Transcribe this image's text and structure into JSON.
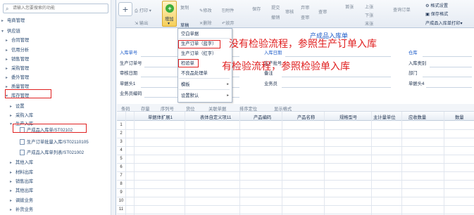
{
  "sidebar": {
    "search_placeholder": "请输入您要搜索的功能",
    "items": [
      {
        "t": "电商管理",
        "toggle": "▸"
      },
      {
        "t": "供应链",
        "toggle": "▾"
      },
      {
        "t": "合同管理",
        "toggle": "▸"
      },
      {
        "t": "信用分析",
        "toggle": "▸"
      },
      {
        "t": "销售管理",
        "toggle": "▸"
      },
      {
        "t": "采购管理",
        "toggle": "▸"
      },
      {
        "t": "委外管理",
        "toggle": "▸"
      },
      {
        "t": "质量管理",
        "toggle": "▸"
      },
      {
        "t": "库存管理",
        "toggle": "▾"
      },
      {
        "t": "设置",
        "toggle": "▸"
      },
      {
        "t": "采购入库",
        "toggle": "▸"
      },
      {
        "t": "生产入库",
        "toggle": "▾"
      },
      {
        "t": "产成品入库单/ST02102",
        "toggle": ""
      },
      {
        "t": "生产订单批量入库/ST02110105",
        "toggle": ""
      },
      {
        "t": "产成品入库单列表/ST021002",
        "toggle": ""
      },
      {
        "t": "其他入库",
        "toggle": "▸"
      },
      {
        "t": "材料出库",
        "toggle": "▸"
      },
      {
        "t": "销售出库",
        "toggle": "▸"
      },
      {
        "t": "其他出库",
        "toggle": "▸"
      },
      {
        "t": "调拨业务",
        "toggle": "▸"
      },
      {
        "t": "补货业务",
        "toggle": "▸"
      }
    ]
  },
  "toolbar": {
    "print": "打印",
    "output": "输出",
    "add": "增加",
    "add_caret": "▾",
    "copy": "复制",
    "draft": "草稿",
    "modify": "修改",
    "delete": "删除",
    "attach": "附件",
    "discard": "放弃",
    "save": "保存",
    "submit": "提交",
    "withdraw": "撤销",
    "audit": "审核",
    "abandon": "弃审",
    "view": "查审",
    "first": "首张",
    "prev": "上张",
    "next": "下张",
    "last": "末张",
    "query_order": "查询订单",
    "format_settings": "格式设置",
    "save_format": "保存格式",
    "print_template": "产成品入库单打印▾"
  },
  "menu": [
    {
      "t": "空白单据",
      "arrow": ""
    },
    {
      "t": "生产订单（蓝字）",
      "arrow": ""
    },
    {
      "t": "生产订单（红字）",
      "arrow": ""
    },
    {
      "t": "检验单",
      "arrow": ""
    },
    {
      "t": "不良品处理单",
      "arrow": ""
    },
    {
      "t": "模板",
      "arrow": "▸"
    },
    {
      "t": "设置默认",
      "arrow": "▸"
    }
  ],
  "form": {
    "title": "产成品入库单",
    "fields": {
      "entry_no": "入库单号",
      "production_order": "生产订单号",
      "audit_date": "审核日期",
      "header1": "单据头1",
      "salesman_code": "业务员编码",
      "entry_date": "入库日期",
      "production_no": "生产批号",
      "remark": "备注",
      "salesman": "业务员",
      "warehouse": "仓库",
      "entry_type": "入库类别",
      "department": "部门",
      "header4": "单据头4"
    }
  },
  "annotations": {
    "a1": "没有检验流程，参照生产订单入库",
    "a2": "有检验流程，参照检验单入库"
  },
  "grid": {
    "toolbar": [
      "条码",
      "存量",
      "序列号",
      "货位",
      "关联单据",
      "排序定位",
      "显示格式"
    ],
    "headers": [
      "单据体扩展1",
      "表体自定义项11",
      "产品编码",
      "产品名称",
      "规格型号",
      "主计量单位",
      "应收数量",
      "数量"
    ],
    "rows": [
      "1",
      "2",
      "3",
      "4",
      "5",
      "6",
      "7",
      "8",
      "9",
      "10",
      "11"
    ]
  },
  "colors": {
    "annotation": "#e02020",
    "link": "#1a5ac8",
    "accent": "#f5cf5a"
  }
}
